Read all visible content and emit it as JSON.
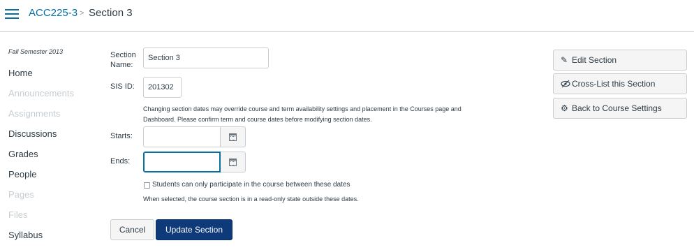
{
  "header": {
    "course": "ACC225-3",
    "separator": ">",
    "current": "Section 3"
  },
  "sidebar": {
    "term": "Fall Semester 2013",
    "items": [
      {
        "label": "Home",
        "enabled": true
      },
      {
        "label": "Announcements",
        "enabled": false
      },
      {
        "label": "Assignments",
        "enabled": false
      },
      {
        "label": "Discussions",
        "enabled": true
      },
      {
        "label": "Grades",
        "enabled": true
      },
      {
        "label": "People",
        "enabled": true
      },
      {
        "label": "Pages",
        "enabled": false
      },
      {
        "label": "Files",
        "enabled": false
      },
      {
        "label": "Syllabus",
        "enabled": true
      }
    ]
  },
  "form": {
    "section_name_label_1": "Section",
    "section_name_label_2": "Name:",
    "section_name_value": "Section 3",
    "sis_id_label": "SIS ID:",
    "sis_id_value": "201302",
    "dates_note_1": "Changing section dates may override course and term availability settings and placement in the Courses page and",
    "dates_note_2": "Dashboard. Please confirm term and course dates before modifying section dates.",
    "starts_label": "Starts:",
    "starts_value": "",
    "ends_label": "Ends:",
    "ends_value": "",
    "restrict_label": "Students can only participate in the course between these dates",
    "restrict_checked": false,
    "restrict_note": "When selected, the course section is in a read-only state outside these dates.",
    "cancel_label": "Cancel",
    "update_label": "Update Section"
  },
  "side_actions": {
    "edit_label": "Edit Section",
    "crosslist_label": "Cross-List this Section",
    "back_label": "Back to Course Settings"
  },
  "icons": {
    "menu": "hamburger-icon",
    "calendar": "calendar-icon",
    "edit": "pencil-icon",
    "crosslist": "eye-slash-icon",
    "settings": "gear-icon"
  },
  "colors": {
    "link": "#0770a3",
    "primary_button": "#0e3a7a",
    "text": "#2d3b45",
    "disabled_text": "#c7cdd1"
  }
}
